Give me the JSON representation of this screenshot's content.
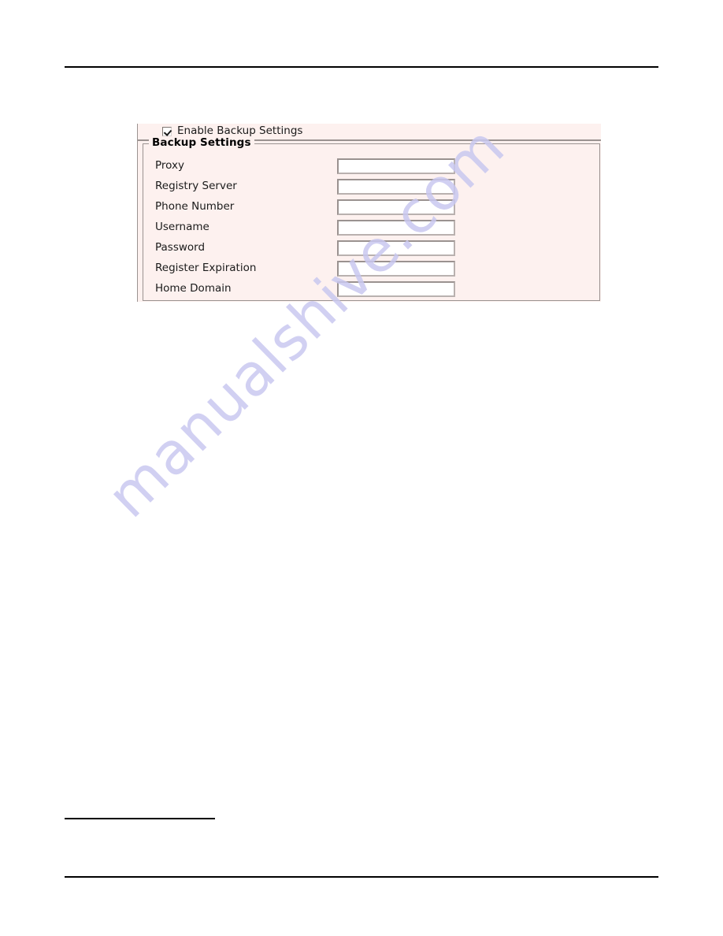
{
  "page": {
    "background_color": "#ffffff",
    "rule_color": "#000000"
  },
  "watermark": {
    "text": "manualshive.com",
    "color": "#c9c8f0"
  },
  "ui_screenshot": {
    "panel_background": "#fdf1ef",
    "border_color": "#9b9391",
    "enable_checkbox": {
      "label": "Enable Backup Settings",
      "checked": true,
      "state_glyph": "checkmark-icon"
    },
    "group": {
      "title": "Backup Settings",
      "fields": [
        {
          "label": "Proxy",
          "value": "",
          "placeholder": ""
        },
        {
          "label": "Registry Server",
          "value": "",
          "placeholder": ""
        },
        {
          "label": "Phone Number",
          "value": "",
          "placeholder": ""
        },
        {
          "label": "Username",
          "value": "",
          "placeholder": ""
        },
        {
          "label": "Password",
          "value": "",
          "placeholder": ""
        },
        {
          "label": "Register Expiration",
          "value": "",
          "placeholder": ""
        },
        {
          "label": "Home Domain",
          "value": "",
          "placeholder": ""
        }
      ]
    }
  }
}
